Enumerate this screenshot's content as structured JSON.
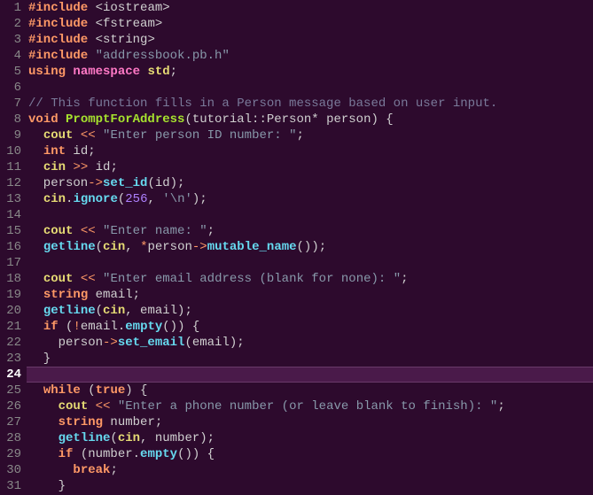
{
  "current_line": 24,
  "lines": [
    {
      "n": 1,
      "tokens": [
        [
          "kw",
          "#include"
        ],
        [
          "punc",
          " <"
        ],
        [
          "id2",
          "iostream"
        ],
        [
          "punc",
          ">"
        ]
      ]
    },
    {
      "n": 2,
      "tokens": [
        [
          "kw",
          "#include"
        ],
        [
          "punc",
          " <"
        ],
        [
          "id2",
          "fstream"
        ],
        [
          "punc",
          ">"
        ]
      ]
    },
    {
      "n": 3,
      "tokens": [
        [
          "kw",
          "#include"
        ],
        [
          "punc",
          " <"
        ],
        [
          "id2",
          "string"
        ],
        [
          "punc",
          ">"
        ]
      ]
    },
    {
      "n": 4,
      "tokens": [
        [
          "kw",
          "#include"
        ],
        [
          "punc",
          " "
        ],
        [
          "str",
          "\"addressbook.pb.h\""
        ]
      ]
    },
    {
      "n": 5,
      "tokens": [
        [
          "kw",
          "using"
        ],
        [
          "punc",
          " "
        ],
        [
          "pink",
          "namespace"
        ],
        [
          "punc",
          " "
        ],
        [
          "gold",
          "std"
        ],
        [
          "punc",
          ";"
        ]
      ]
    },
    {
      "n": 6,
      "tokens": []
    },
    {
      "n": 7,
      "tokens": [
        [
          "cmt",
          "// This function fills in a Person message based on user input."
        ]
      ]
    },
    {
      "n": 8,
      "tokens": [
        [
          "kw",
          "void"
        ],
        [
          "punc",
          " "
        ],
        [
          "ns",
          "PromptForAddress"
        ],
        [
          "punc",
          "(tutorial::Person* person) {"
        ]
      ]
    },
    {
      "n": 9,
      "tokens": [
        [
          "punc",
          "  "
        ],
        [
          "gold",
          "cout"
        ],
        [
          "punc",
          " "
        ],
        [
          "op",
          "<<"
        ],
        [
          "punc",
          " "
        ],
        [
          "str",
          "\"Enter person ID number: \""
        ],
        [
          "punc",
          ";"
        ]
      ]
    },
    {
      "n": 10,
      "tokens": [
        [
          "punc",
          "  "
        ],
        [
          "kw",
          "int"
        ],
        [
          "punc",
          " id;"
        ]
      ]
    },
    {
      "n": 11,
      "tokens": [
        [
          "punc",
          "  "
        ],
        [
          "gold",
          "cin"
        ],
        [
          "punc",
          " "
        ],
        [
          "op",
          ">>"
        ],
        [
          "punc",
          " id;"
        ]
      ]
    },
    {
      "n": 12,
      "tokens": [
        [
          "punc",
          "  person"
        ],
        [
          "op",
          "->"
        ],
        [
          "fn",
          "set_id"
        ],
        [
          "punc",
          "(id);"
        ]
      ]
    },
    {
      "n": 13,
      "tokens": [
        [
          "punc",
          "  "
        ],
        [
          "gold",
          "cin"
        ],
        [
          "punc",
          "."
        ],
        [
          "fn",
          "ignore"
        ],
        [
          "punc",
          "("
        ],
        [
          "num",
          "256"
        ],
        [
          "punc",
          ", "
        ],
        [
          "str",
          "'\\n'"
        ],
        [
          "punc",
          ");"
        ]
      ]
    },
    {
      "n": 14,
      "tokens": []
    },
    {
      "n": 15,
      "tokens": [
        [
          "punc",
          "  "
        ],
        [
          "gold",
          "cout"
        ],
        [
          "punc",
          " "
        ],
        [
          "op",
          "<<"
        ],
        [
          "punc",
          " "
        ],
        [
          "str",
          "\"Enter name: \""
        ],
        [
          "punc",
          ";"
        ]
      ]
    },
    {
      "n": 16,
      "tokens": [
        [
          "punc",
          "  "
        ],
        [
          "fn",
          "getline"
        ],
        [
          "punc",
          "("
        ],
        [
          "gold",
          "cin"
        ],
        [
          "punc",
          ", "
        ],
        [
          "op",
          "*"
        ],
        [
          "punc",
          "person"
        ],
        [
          "op",
          "->"
        ],
        [
          "fn",
          "mutable_name"
        ],
        [
          "punc",
          "());"
        ]
      ]
    },
    {
      "n": 17,
      "tokens": []
    },
    {
      "n": 18,
      "tokens": [
        [
          "punc",
          "  "
        ],
        [
          "gold",
          "cout"
        ],
        [
          "punc",
          " "
        ],
        [
          "op",
          "<<"
        ],
        [
          "punc",
          " "
        ],
        [
          "str",
          "\"Enter email address (blank for none): \""
        ],
        [
          "punc",
          ";"
        ]
      ]
    },
    {
      "n": 19,
      "tokens": [
        [
          "punc",
          "  "
        ],
        [
          "kw",
          "string"
        ],
        [
          "punc",
          " email;"
        ]
      ]
    },
    {
      "n": 20,
      "tokens": [
        [
          "punc",
          "  "
        ],
        [
          "fn",
          "getline"
        ],
        [
          "punc",
          "("
        ],
        [
          "gold",
          "cin"
        ],
        [
          "punc",
          ", email);"
        ]
      ]
    },
    {
      "n": 21,
      "tokens": [
        [
          "punc",
          "  "
        ],
        [
          "kw",
          "if"
        ],
        [
          "punc",
          " ("
        ],
        [
          "op",
          "!"
        ],
        [
          "punc",
          "email."
        ],
        [
          "fn",
          "empty"
        ],
        [
          "punc",
          "()) {"
        ]
      ]
    },
    {
      "n": 22,
      "tokens": [
        [
          "punc",
          "    person"
        ],
        [
          "op",
          "->"
        ],
        [
          "fn",
          "set_email"
        ],
        [
          "punc",
          "(email);"
        ]
      ]
    },
    {
      "n": 23,
      "tokens": [
        [
          "punc",
          "  }"
        ]
      ]
    },
    {
      "n": 24,
      "tokens": []
    },
    {
      "n": 25,
      "tokens": [
        [
          "punc",
          "  "
        ],
        [
          "kw",
          "while"
        ],
        [
          "punc",
          " ("
        ],
        [
          "kw",
          "true"
        ],
        [
          "punc",
          ") {"
        ]
      ]
    },
    {
      "n": 26,
      "tokens": [
        [
          "punc",
          "    "
        ],
        [
          "gold",
          "cout"
        ],
        [
          "punc",
          " "
        ],
        [
          "op",
          "<<"
        ],
        [
          "punc",
          " "
        ],
        [
          "str",
          "\"Enter a phone number (or leave blank to finish): \""
        ],
        [
          "punc",
          ";"
        ]
      ]
    },
    {
      "n": 27,
      "tokens": [
        [
          "punc",
          "    "
        ],
        [
          "kw",
          "string"
        ],
        [
          "punc",
          " number;"
        ]
      ]
    },
    {
      "n": 28,
      "tokens": [
        [
          "punc",
          "    "
        ],
        [
          "fn",
          "getline"
        ],
        [
          "punc",
          "("
        ],
        [
          "gold",
          "cin"
        ],
        [
          "punc",
          ", number);"
        ]
      ]
    },
    {
      "n": 29,
      "tokens": [
        [
          "punc",
          "    "
        ],
        [
          "kw",
          "if"
        ],
        [
          "punc",
          " (number."
        ],
        [
          "fn",
          "empty"
        ],
        [
          "punc",
          "()) {"
        ]
      ]
    },
    {
      "n": 30,
      "tokens": [
        [
          "punc",
          "      "
        ],
        [
          "kw",
          "break"
        ],
        [
          "punc",
          ";"
        ]
      ]
    },
    {
      "n": 31,
      "tokens": [
        [
          "punc",
          "    }"
        ]
      ]
    }
  ]
}
